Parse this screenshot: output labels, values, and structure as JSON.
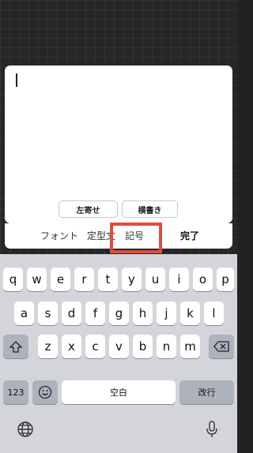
{
  "editor": {
    "align_button": "左寄せ",
    "orientation_button": "横書き"
  },
  "toolbar": {
    "font": "フォント",
    "template": "定型文",
    "symbol": "記号",
    "done": "完了"
  },
  "keyboard": {
    "row1": [
      "q",
      "w",
      "e",
      "r",
      "t",
      "y",
      "u",
      "i",
      "o",
      "p"
    ],
    "row2": [
      "a",
      "s",
      "d",
      "f",
      "g",
      "h",
      "j",
      "k",
      "l"
    ],
    "row3": [
      "z",
      "x",
      "c",
      "v",
      "b",
      "n",
      "m"
    ],
    "numbers_key": "123",
    "space_key": "空白",
    "return_key": "改行"
  },
  "colors": {
    "highlight": "#e44a3b",
    "keyboard_bg": "#d3d5db",
    "function_key": "#adb3bc"
  }
}
